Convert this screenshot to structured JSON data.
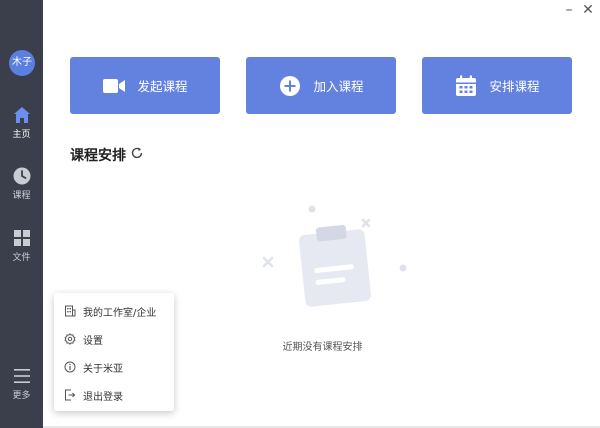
{
  "window": {
    "minimize_glyph": "–",
    "close_glyph": "✕"
  },
  "sidebar": {
    "avatar_text": "木子",
    "items": [
      {
        "label": "主页",
        "icon": "home-icon",
        "active": true
      },
      {
        "label": "课程",
        "icon": "clock-icon",
        "active": false
      },
      {
        "label": "文件",
        "icon": "grid-icon",
        "active": false
      },
      {
        "label": "更多",
        "icon": "menu-icon",
        "active": false
      }
    ]
  },
  "actions": [
    {
      "label": "发起课程",
      "icon": "video-camera-icon"
    },
    {
      "label": "加入课程",
      "icon": "plus-circle-icon"
    },
    {
      "label": "安排课程",
      "icon": "calendar-icon"
    }
  ],
  "schedule": {
    "title": "课程安排",
    "empty_text": "近期没有课程安排"
  },
  "more_menu": {
    "items": [
      {
        "label": "我的工作室/企业",
        "icon": "building-icon"
      },
      {
        "label": "设置",
        "icon": "gear-icon"
      },
      {
        "label": "关于米亚",
        "icon": "info-icon"
      },
      {
        "label": "退出登录",
        "icon": "logout-icon"
      }
    ]
  },
  "colors": {
    "sidebar_bg": "#3b3f4c",
    "accent": "#6382e0",
    "avatar": "#5b7fe0"
  }
}
